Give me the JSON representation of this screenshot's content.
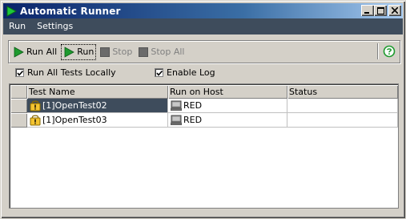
{
  "window": {
    "title": "Automatic Runner",
    "icon": "green-play-icon",
    "controls": [
      "minimize-icon",
      "maximize-icon",
      "close-icon"
    ]
  },
  "menu": [
    {
      "label": "Run"
    },
    {
      "label": "Settings"
    }
  ],
  "toolbar": {
    "run_all_label": "Run All",
    "run_label": "Run",
    "stop_label": "Stop",
    "stop_all_label": "Stop All",
    "help_icon": "help-icon"
  },
  "options": {
    "run_locally_label": "Run All Tests Locally",
    "run_locally_checked": true,
    "enable_log_label": "Enable Log",
    "enable_log_checked": true
  },
  "table": {
    "columns": [
      "Test Name",
      "Run on Host",
      "Status"
    ],
    "rows": [
      {
        "name": "[1]OpenTest02",
        "host": "RED",
        "status": "",
        "selected": true,
        "icon": "warning-lock-icon",
        "host_icon": "computer-icon"
      },
      {
        "name": "[1]OpenTest03",
        "host": "RED",
        "status": "",
        "selected": false,
        "icon": "warning-lock-icon",
        "host_icon": "computer-icon"
      }
    ]
  },
  "colors": {
    "accent_dark": "#3e4c5c",
    "play_green": "#1e9a2e",
    "face": "#d4d0c8"
  }
}
